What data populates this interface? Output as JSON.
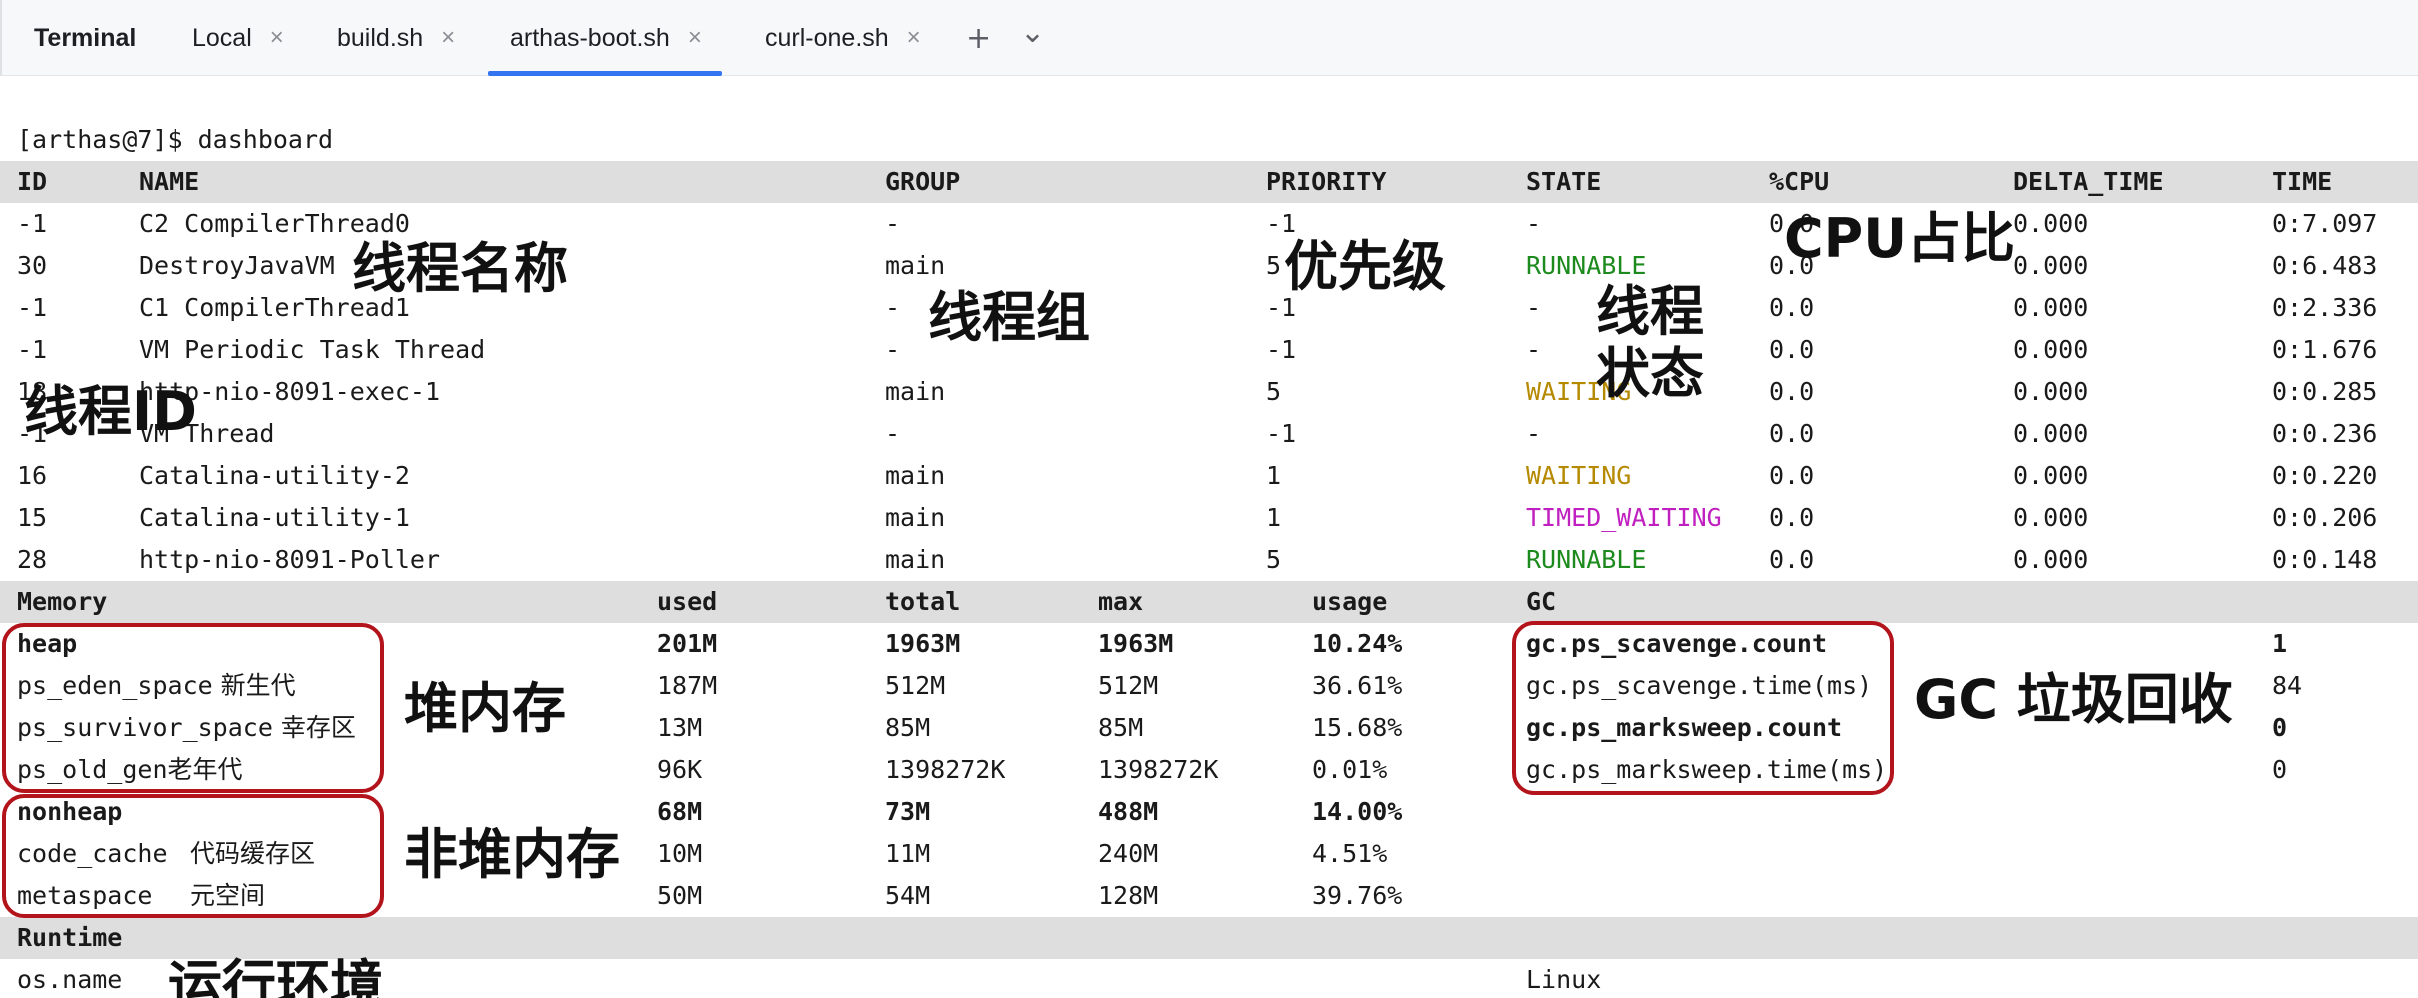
{
  "tabs": {
    "title": "Terminal",
    "items": [
      {
        "label": "Local"
      },
      {
        "label": "build.sh"
      },
      {
        "label": "arthas-boot.sh"
      },
      {
        "label": "curl-one.sh"
      }
    ],
    "close_glyph": "×",
    "add_glyph": "+",
    "more_glyph": "⌄"
  },
  "terminal": {
    "prompt": "[arthas@7]$ dashboard",
    "thread_headers": [
      "ID",
      "NAME",
      "GROUP",
      "PRIORITY",
      "STATE",
      "%CPU",
      "DELTA_TIME",
      "TIME"
    ],
    "threads": [
      {
        "id": "-1",
        "name": "C2 CompilerThread0",
        "group": "-",
        "priority": "-1",
        "state": "-",
        "cpu": "0.0",
        "delta": "0.000",
        "time": "0:7.097"
      },
      {
        "id": "30",
        "name": "DestroyJavaVM",
        "group": "main",
        "priority": "5",
        "state": "RUNNABLE",
        "cpu": "0.0",
        "delta": "0.000",
        "time": "0:6.483"
      },
      {
        "id": "-1",
        "name": "C1 CompilerThread1",
        "group": "-",
        "priority": "-1",
        "state": "-",
        "cpu": "0.0",
        "delta": "0.000",
        "time": "0:2.336"
      },
      {
        "id": "-1",
        "name": "VM Periodic Task Thread",
        "group": "-",
        "priority": "-1",
        "state": "-",
        "cpu": "0.0",
        "delta": "0.000",
        "time": "0:1.676"
      },
      {
        "id": "18",
        "name": "http-nio-8091-exec-1",
        "group": "main",
        "priority": "5",
        "state": "WAITING",
        "cpu": "0.0",
        "delta": "0.000",
        "time": "0:0.285"
      },
      {
        "id": "-1",
        "name": "VM Thread",
        "group": "-",
        "priority": "-1",
        "state": "-",
        "cpu": "0.0",
        "delta": "0.000",
        "time": "0:0.236"
      },
      {
        "id": "16",
        "name": "Catalina-utility-2",
        "group": "main",
        "priority": "1",
        "state": "WAITING",
        "cpu": "0.0",
        "delta": "0.000",
        "time": "0:0.220"
      },
      {
        "id": "15",
        "name": "Catalina-utility-1",
        "group": "main",
        "priority": "1",
        "state": "TIMED_WAITING",
        "cpu": "0.0",
        "delta": "0.000",
        "time": "0:0.206"
      },
      {
        "id": "28",
        "name": "http-nio-8091-Poller",
        "group": "main",
        "priority": "5",
        "state": "RUNNABLE",
        "cpu": "0.0",
        "delta": "0.000",
        "time": "0:0.148"
      }
    ],
    "state_colors": {
      "RUNNABLE": "#1d8a1d",
      "WAITING": "#b58900",
      "TIMED_WAITING": "#c020c0"
    },
    "memory_headers": [
      "Memory",
      "used",
      "total",
      "max",
      "usage",
      "GC"
    ],
    "memory": [
      {
        "name": "heap",
        "note": "",
        "used": "201M",
        "total": "1963M",
        "max": "1963M",
        "usage": "10.24%",
        "bold": true
      },
      {
        "name": "ps_eden_space",
        "note": " 新生代",
        "used": "187M",
        "total": "512M",
        "max": "512M",
        "usage": "36.61%",
        "bold": false
      },
      {
        "name": "ps_survivor_space",
        "note": " 幸存区",
        "used": "13M",
        "total": "85M",
        "max": "85M",
        "usage": "15.68%",
        "bold": false
      },
      {
        "name": "ps_old_gen",
        "note": "老年代",
        "used": "96K",
        "total": "1398272K",
        "max": "1398272K",
        "usage": "0.01%",
        "bold": false
      },
      {
        "name": "nonheap",
        "note": "",
        "used": "68M",
        "total": "73M",
        "max": "488M",
        "usage": "14.00%",
        "bold": true
      },
      {
        "name": "code_cache",
        "note": "代码缓存区",
        "used": "10M",
        "total": "11M",
        "max": "240M",
        "usage": "4.51%",
        "bold": false
      },
      {
        "name": "metaspace",
        "note": "元空间",
        "used": "50M",
        "total": "54M",
        "max": "128M",
        "usage": "39.76%",
        "bold": false
      }
    ],
    "gc": [
      {
        "name": "gc.ps_scavenge.count",
        "value": "1",
        "bold": true
      },
      {
        "name": "gc.ps_scavenge.time(ms)",
        "value": "84",
        "bold": false
      },
      {
        "name": "gc.ps_marksweep.count",
        "value": "0",
        "bold": true
      },
      {
        "name": "gc.ps_marksweep.time(ms)",
        "value": "0",
        "bold": false
      }
    ],
    "runtime_header": "Runtime",
    "runtime": [
      {
        "name": "os.name",
        "value": "Linux"
      }
    ]
  },
  "annotations": {
    "thread_name": "线程名称",
    "thread_group": "线程组",
    "priority": "优先级",
    "cpu_ratio": "CPU占比",
    "thread_state_1": "线程",
    "thread_state_2": "状态",
    "thread_id": "线程ID",
    "heap": "堆内存",
    "nonheap": "非堆内存",
    "gc": "GC 垃圾回收",
    "runtime": "运行环境"
  },
  "colors": {
    "accent": "#3574f0",
    "annotation_box": "#b3141c",
    "header_bg": "#dedede"
  }
}
